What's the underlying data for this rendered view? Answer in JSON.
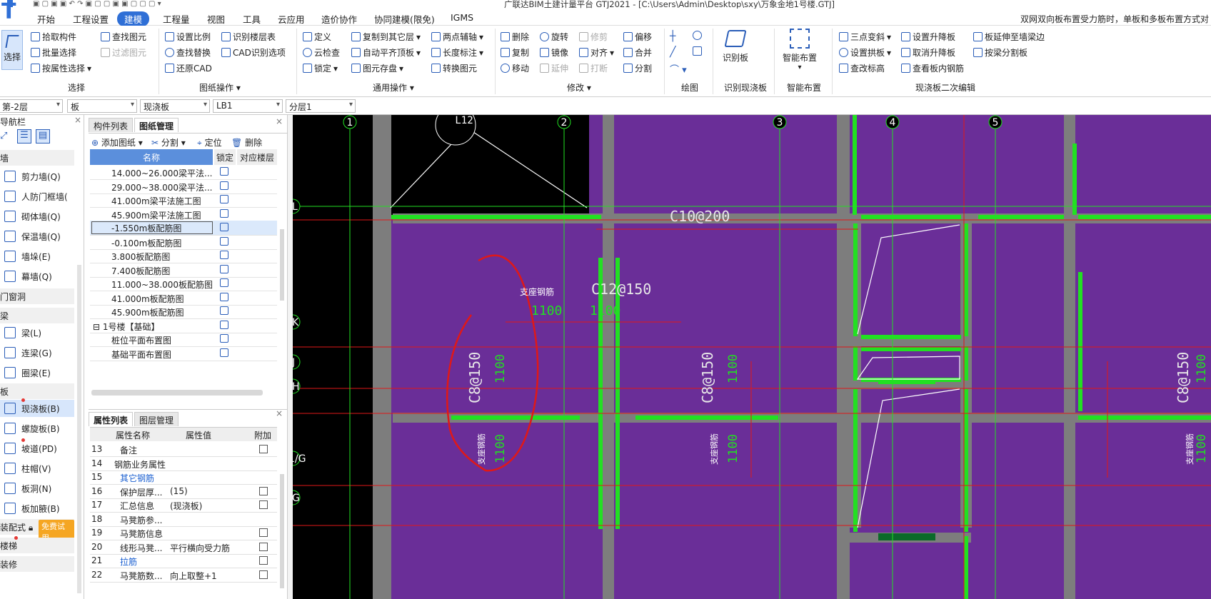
{
  "titlebar": {
    "title": "广联达BIM土建计量平台 GTJ2021 - [C:\\Users\\Admin\\Desktop\\sxy\\万象金地1号楼.GTJ]"
  },
  "menu": {
    "items": [
      "开始",
      "工程设置",
      "建模",
      "工程量",
      "视图",
      "工具",
      "云应用",
      "造价协作",
      "协同建模(限免)",
      "IGMS"
    ],
    "active": "建模",
    "notice": "双网双向板布置受力筋时，单板和多板布置方式对"
  },
  "ribbon": {
    "select_group": {
      "big": "选择",
      "items": [
        "拾取构件",
        "批量选择",
        "按属性选择",
        "查找图元",
        "过滤图元"
      ],
      "label": "选择"
    },
    "drawing_ops": {
      "items": [
        "设置比例",
        "查找替换",
        "还原CAD",
        "识别楼层表",
        "CAD识别选项"
      ],
      "label": "图纸操作"
    },
    "general_ops": {
      "items": [
        "定义",
        "云检查",
        "锁定",
        "复制到其它层",
        "自动平齐顶板",
        "图元存盘",
        "两点辅轴",
        "长度标注",
        "转换图元"
      ],
      "label": "通用操作"
    },
    "modify": {
      "items": [
        "删除",
        "复制",
        "移动",
        "旋转",
        "镜像",
        "延伸",
        "修剪",
        "对齐",
        "打断",
        "偏移",
        "合并",
        "分割"
      ],
      "label": "修改"
    },
    "draw": {
      "label": "绘图"
    },
    "recognize": {
      "big": "识别板",
      "label": "识别现浇板"
    },
    "smart": {
      "big": "智能布置",
      "label": "智能布置"
    },
    "secondary": {
      "items": [
        "三点变斜",
        "设置拱板",
        "查改标高",
        "设置升降板",
        "取消升降板",
        "查看板内钢筋",
        "板延伸至墙梁边",
        "按梁分割板"
      ],
      "label": "现浇板二次编辑"
    }
  },
  "combos": [
    "第-2层",
    "板",
    "现浇板",
    "LB1",
    "分层1"
  ],
  "nav": {
    "title": "导航栏",
    "categories": [
      "墙",
      "门窗洞",
      "梁",
      "板",
      "装配式",
      "楼梯",
      "装修"
    ],
    "wall_items": [
      "剪力墙(Q)",
      "人防门框墙(",
      "砌体墙(Q)",
      "保温墙(Q)",
      "墙垛(E)",
      "幕墙(Q)"
    ],
    "beam_items": [
      "梁(L)",
      "连梁(G)",
      "圈梁(E)"
    ],
    "slab_items": [
      "现浇板(B)",
      "螺旋板(B)",
      "坡道(PD)",
      "柱帽(V)",
      "板洞(N)",
      "板加腋(B)"
    ],
    "trial_badge": "免费试用"
  },
  "drawing_panel": {
    "tabs": [
      "构件列表",
      "图纸管理"
    ],
    "toolbar": [
      "添加图纸",
      "分割",
      "定位",
      "删除"
    ],
    "columns": [
      "名称",
      "锁定",
      "对应楼层"
    ],
    "rows": [
      "14.000~26.000梁平法...",
      "29.000~38.000梁平法...",
      "41.000m梁平法施工图",
      "45.900m梁平法施工图",
      "-1.550m板配筋图",
      "-0.100m板配筋图",
      "3.800板配筋图",
      "7.400板配筋图",
      "11.000~38.000板配筋图",
      "41.000m板配筋图",
      "45.900m板配筋图",
      "1号楼【基础】",
      "桩位平面布置图",
      "基础平面布置图"
    ]
  },
  "props_panel": {
    "tabs": [
      "属性列表",
      "图层管理"
    ],
    "columns": [
      "属性名称",
      "属性值",
      "附加"
    ],
    "rows": [
      {
        "no": "13",
        "name": "备注",
        "value": ""
      },
      {
        "no": "14",
        "name": "钢筋业务属性",
        "value": ""
      },
      {
        "no": "15",
        "name": "其它钢筋",
        "value": ""
      },
      {
        "no": "16",
        "name": "保护层厚...",
        "value": "(15)"
      },
      {
        "no": "17",
        "name": "汇总信息",
        "value": "(现浇板)"
      },
      {
        "no": "18",
        "name": "马凳筋参...",
        "value": ""
      },
      {
        "no": "19",
        "name": "马凳筋信息",
        "value": ""
      },
      {
        "no": "20",
        "name": "线形马凳...",
        "value": "平行横向受力筋"
      },
      {
        "no": "21",
        "name": "拉筋",
        "value": ""
      },
      {
        "no": "22",
        "name": "马凳筋数...",
        "value": "向上取整+1"
      }
    ]
  },
  "canvas": {
    "axes_top": [
      "1",
      "2",
      "3",
      "4",
      "5"
    ],
    "axes_left": [
      "L",
      "K",
      "J",
      "H",
      "1/G",
      "G"
    ],
    "circle_label": "L12",
    "labels": {
      "c10": "C10@200",
      "c12": "C12@150",
      "c8": "C8@150",
      "len": "1100",
      "note": "支座钢筋"
    },
    "colors": {
      "slab": "#6a2e98",
      "beam": "#7a7a7a",
      "rebar": "#22e022",
      "axis": "#e01818"
    }
  }
}
